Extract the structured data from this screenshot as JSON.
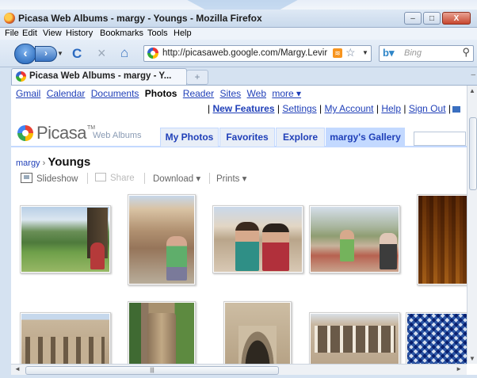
{
  "window": {
    "title": "Picasa Web Albums - margy - Youngs - Mozilla Firefox",
    "minimize_glyph": "–",
    "maximize_glyph": "□",
    "close_glyph": "X"
  },
  "menubar": [
    "File",
    "Edit",
    "View",
    "History",
    "Bookmarks",
    "Tools",
    "Help"
  ],
  "toolbar": {
    "url": "http://picasaweb.google.com/Margy.Levir",
    "search_placeholder": "Bing",
    "back_glyph": "‹",
    "forward_glyph": "›",
    "reload_glyph": "C",
    "stop_glyph": "×",
    "home_glyph": "⌂",
    "star_glyph": "☆",
    "search_glyph": "⚲"
  },
  "tabs": [
    {
      "label": "Picasa Web Albums - margy - Y..."
    }
  ],
  "newtab_glyph": "+",
  "google_bar": {
    "links": [
      "Gmail",
      "Calendar",
      "Documents"
    ],
    "current": "Photos",
    "more_links": [
      "Reader",
      "Sites",
      "Web",
      "more ▾"
    ]
  },
  "user_bar": {
    "new_features": "New Features",
    "settings": "Settings",
    "my_account": "My Account",
    "help": "Help",
    "sign_out": "Sign Out",
    "separator": "|"
  },
  "picasa_header": {
    "logo": "Picasa",
    "logo_tm": "TM",
    "logo_sub": "Web Albums",
    "tabs": [
      "My Photos",
      "Favorites",
      "Explore",
      "margy's Gallery"
    ],
    "selected_tab": "margy's Gallery"
  },
  "breadcrumb": {
    "user": "margy",
    "arrow": "›",
    "album": "Youngs"
  },
  "actions": {
    "slideshow": "Slideshow",
    "share": "Share",
    "download": "Download ▾",
    "prints": "Prints ▾"
  },
  "scrollbar": {
    "grip": "|||",
    "up": "▲",
    "down": "▼",
    "left": "◄",
    "right": "►"
  },
  "photos": [
    {
      "subject": "park with garden and woman"
    },
    {
      "subject": "castle wall and woman in green"
    },
    {
      "subject": "two women smiling"
    },
    {
      "subject": "family at outdoor table"
    },
    {
      "subject": "ornate golden altar"
    },
    {
      "subject": "building facade with arches"
    },
    {
      "subject": "round stone tower"
    },
    {
      "subject": "ornate stone doorway"
    },
    {
      "subject": "cloister with arcades"
    },
    {
      "subject": "blue tile pattern"
    }
  ],
  "colors": {
    "link": "#1f3fb8",
    "picasa_tab": "#e8eef7",
    "picasa_tab_selected": "#c3d9ff"
  }
}
